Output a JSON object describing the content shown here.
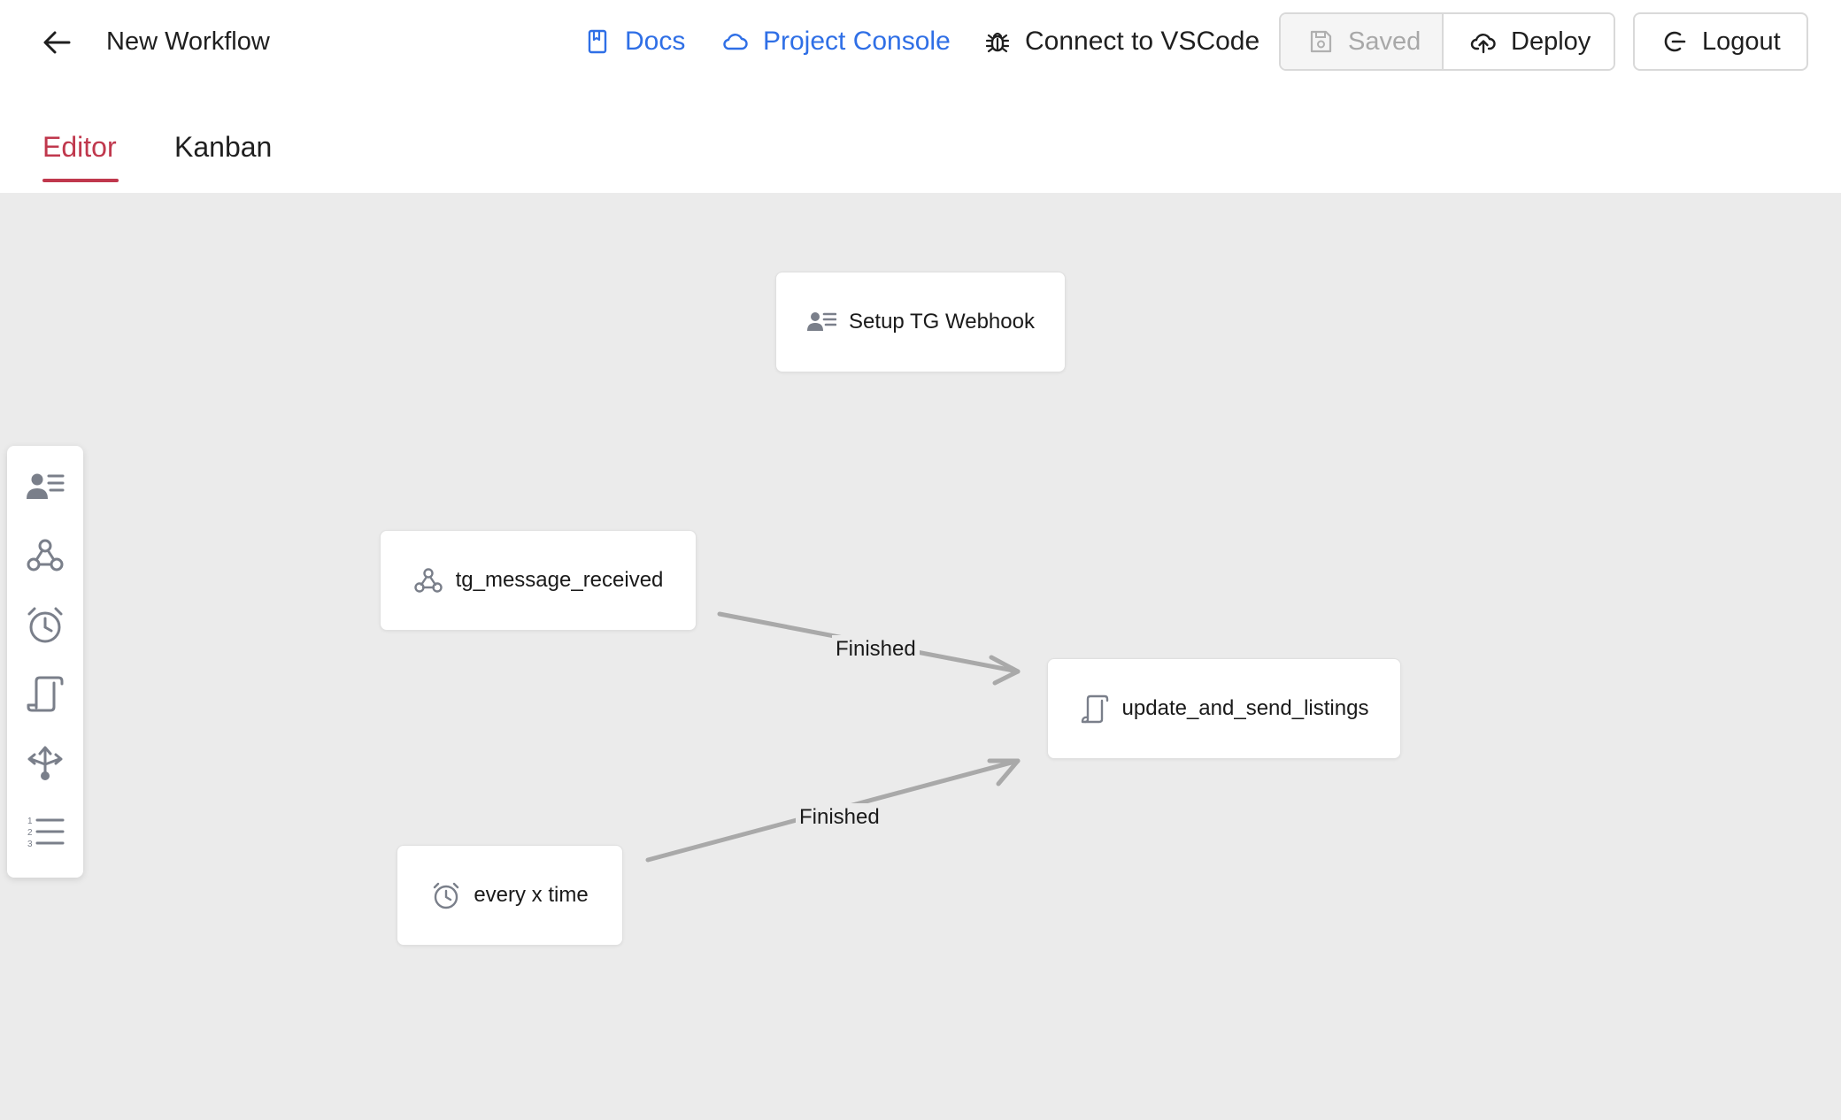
{
  "header": {
    "workflow_title": "New Workflow",
    "links": {
      "docs": "Docs",
      "console": "Project Console",
      "vscode": "Connect to VSCode"
    },
    "buttons": {
      "saved": "Saved",
      "deploy": "Deploy",
      "logout": "Logout"
    }
  },
  "tabs": [
    {
      "label": "Editor",
      "active": true
    },
    {
      "label": "Kanban",
      "active": false
    }
  ],
  "colors": {
    "accent_red": "#c0384d",
    "link_blue": "#2f6fe6",
    "canvas_bg": "#ebebeb",
    "edge_gray": "#a9a9a9",
    "icon_gray": "#7a7f8a"
  },
  "nodes": [
    {
      "id": "setup",
      "label": "Setup TG Webhook",
      "icon": "user-list-icon"
    },
    {
      "id": "tg",
      "label": "tg_message_received",
      "icon": "webhook-icon"
    },
    {
      "id": "update",
      "label": "update_and_send_listings",
      "icon": "script-icon"
    },
    {
      "id": "every",
      "label": "every x time",
      "icon": "clock-icon"
    }
  ],
  "edges": [
    {
      "from": "tg",
      "to": "update",
      "label": "Finished"
    },
    {
      "from": "every",
      "to": "update",
      "label": "Finished"
    }
  ],
  "palette": [
    {
      "icon": "user-list-icon"
    },
    {
      "icon": "webhook-icon"
    },
    {
      "icon": "clock-icon"
    },
    {
      "icon": "script-icon"
    },
    {
      "icon": "split-arrows-icon"
    },
    {
      "icon": "numbered-list-icon"
    }
  ]
}
